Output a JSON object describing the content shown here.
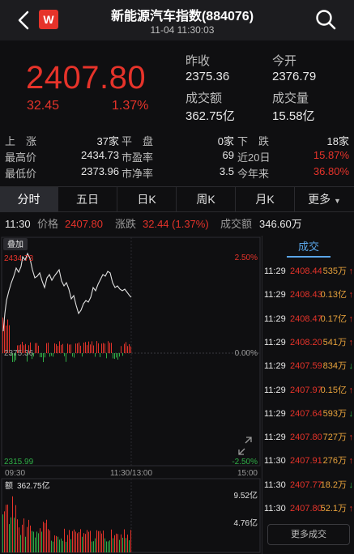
{
  "header": {
    "title": "新能源汽车指数(884076)",
    "subtitle": "11-04 11:30:03",
    "logo_letter": "W"
  },
  "quote": {
    "price": "2407.80",
    "change": "32.45",
    "change_pct": "1.37%",
    "prev_close_label": "昨收",
    "prev_close": "2375.36",
    "open_label": "今开",
    "open": "2376.79",
    "amount_label": "成交额",
    "amount": "362.75亿",
    "volume_label": "成交量",
    "volume": "15.58亿"
  },
  "stats": {
    "rows": [
      [
        "上　涨",
        "37家",
        "平　盘",
        "0家",
        "下　跌",
        "18家"
      ],
      [
        "最高价",
        "2434.73",
        "市盈率",
        "69",
        "近20日",
        "15.87%"
      ],
      [
        "最低价",
        "2373.96",
        "市净率",
        "3.5",
        "今年来",
        "36.80%"
      ]
    ]
  },
  "tabs": [
    "分时",
    "五日",
    "日K",
    "周K",
    "月K",
    "更多"
  ],
  "infobar": {
    "time": "11:30",
    "price_label": "价格",
    "price": "2407.80",
    "change_label": "涨跌",
    "change": "32.44 (1.37%)",
    "amount_label": "成交额",
    "amount": "346.60万"
  },
  "chart": {
    "overlay_label": "叠加",
    "high_label": "2434.73",
    "high_pct": "2.50%",
    "mid_label": "2375.36",
    "mid_pct": "0.00%",
    "low_label": "2315.99",
    "low_pct": "-2.50%",
    "time_start": "09:30",
    "time_mid": "11:30/13:00",
    "time_end": "15:00",
    "vol_label": "额",
    "vol_value": "362.75亿",
    "vol_tick_high": "9.52亿",
    "vol_tick_mid": "4.76亿"
  },
  "trades": {
    "title": "成交",
    "rows": [
      {
        "time": "11:29",
        "price": "2408.44",
        "amount": "535万",
        "dir": "up"
      },
      {
        "time": "11:29",
        "price": "2408.43",
        "amount": "0.13亿",
        "dir": "up"
      },
      {
        "time": "11:29",
        "price": "2408.47",
        "amount": "0.17亿",
        "dir": "up"
      },
      {
        "time": "11:29",
        "price": "2408.20",
        "amount": "541万",
        "dir": "up"
      },
      {
        "time": "11:29",
        "price": "2407.59",
        "amount": "834万",
        "dir": "down"
      },
      {
        "time": "11:29",
        "price": "2407.97",
        "amount": "0.15亿",
        "dir": "up"
      },
      {
        "time": "11:29",
        "price": "2407.64",
        "amount": "593万",
        "dir": "down"
      },
      {
        "time": "11:29",
        "price": "2407.80",
        "amount": "727万",
        "dir": "up"
      },
      {
        "time": "11:30",
        "price": "2407.91",
        "amount": "276万",
        "dir": "up"
      },
      {
        "time": "11:30",
        "price": "2407.77",
        "amount": "18.2万",
        "dir": "down"
      },
      {
        "time": "11:30",
        "price": "2407.80",
        "amount": "52.1万",
        "dir": "up"
      }
    ],
    "more_label": "更多成交"
  },
  "colors": {
    "up": "#e6332a",
    "down": "#2fae47",
    "accent": "#5aa5e8",
    "amber": "#e8a33c"
  }
}
